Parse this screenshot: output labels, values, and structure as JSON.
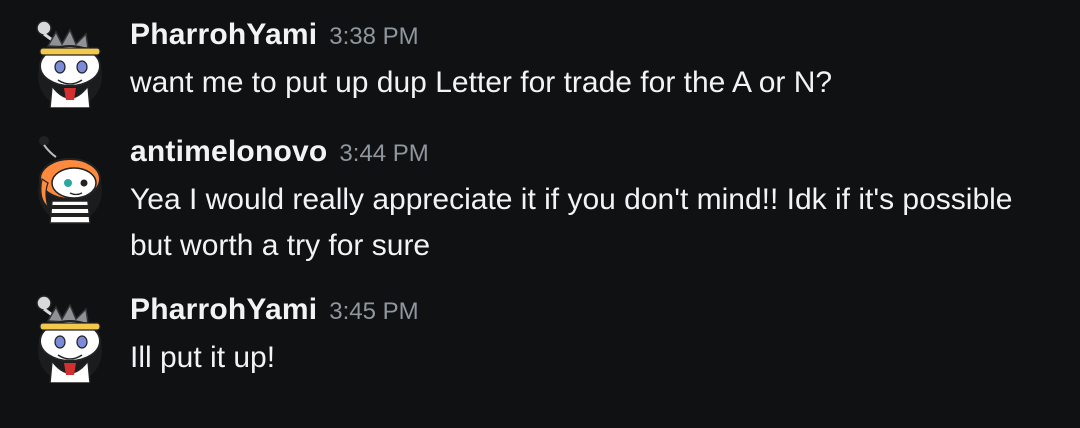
{
  "messages": [
    {
      "username": "PharrohYami",
      "time": "3:38 PM",
      "text": "want me to put up dup Letter for trade for the A or N?",
      "avatar_icon": "snoo-avatar-headband"
    },
    {
      "username": "antimelonovo",
      "time": "3:44 PM",
      "text": "Yea I would really appreciate it if you don't mind!! Idk if it's possible but worth a try for sure",
      "avatar_icon": "snoo-avatar-orange-hair"
    },
    {
      "username": "PharrohYami",
      "time": "3:45 PM",
      "text": "Ill put it up!",
      "avatar_icon": "snoo-avatar-headband"
    }
  ],
  "colors": {
    "background": "#0f1113",
    "text": "#f2f3f5",
    "timestamp": "#8f969e"
  }
}
